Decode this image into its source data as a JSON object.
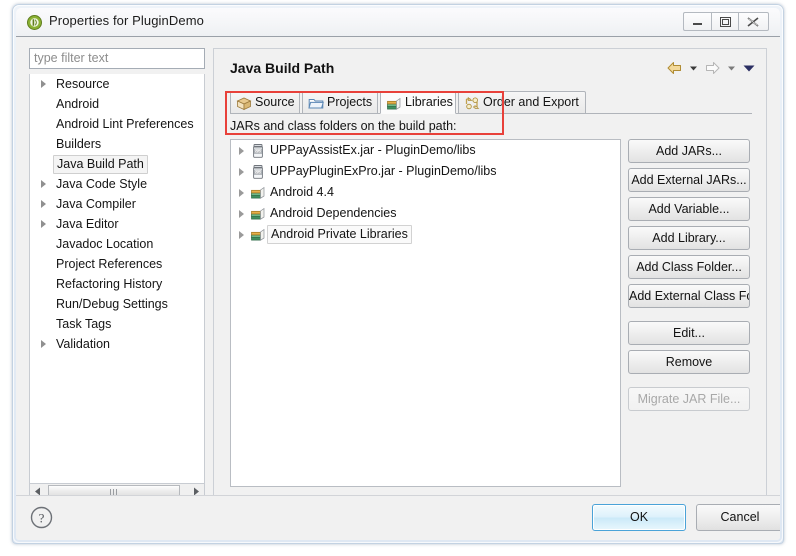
{
  "window": {
    "title": "Properties for PluginDemo",
    "icon": "eclipse-green-circle-icon",
    "controls": {
      "minimize": "minimize-icon",
      "maximize": "maximize-icon",
      "close": "close-icon"
    }
  },
  "sidebar": {
    "filter": {
      "placeholder": "type filter text",
      "value": ""
    },
    "items": [
      {
        "label": "Resource",
        "expandable": true,
        "selected": false
      },
      {
        "label": "Android",
        "expandable": false,
        "selected": false
      },
      {
        "label": "Android Lint Preferences",
        "expandable": false,
        "selected": false
      },
      {
        "label": "Builders",
        "expandable": false,
        "selected": false
      },
      {
        "label": "Java Build Path",
        "expandable": false,
        "selected": true
      },
      {
        "label": "Java Code Style",
        "expandable": true,
        "selected": false
      },
      {
        "label": "Java Compiler",
        "expandable": true,
        "selected": false
      },
      {
        "label": "Java Editor",
        "expandable": true,
        "selected": false
      },
      {
        "label": "Javadoc Location",
        "expandable": false,
        "selected": false
      },
      {
        "label": "Project References",
        "expandable": false,
        "selected": false
      },
      {
        "label": "Refactoring History",
        "expandable": false,
        "selected": false
      },
      {
        "label": "Run/Debug Settings",
        "expandable": false,
        "selected": false
      },
      {
        "label": "Task Tags",
        "expandable": false,
        "selected": false
      },
      {
        "label": "Validation",
        "expandable": true,
        "selected": false
      }
    ]
  },
  "main": {
    "page_title": "Java Build Path",
    "nav": {
      "back": "back-arrow-icon",
      "back_menu": "back-dropdown-icon",
      "forward": "forward-arrow-icon",
      "forward_menu": "forward-dropdown-icon",
      "menu": "view-menu-icon"
    },
    "tabs": [
      {
        "label": "Source",
        "icon": "source-package-icon",
        "active": false
      },
      {
        "label": "Projects",
        "icon": "folder-icon",
        "active": false
      },
      {
        "label": "Libraries",
        "icon": "library-books-icon",
        "active": true
      },
      {
        "label": "Order and Export",
        "icon": "order-export-icon",
        "active": false
      }
    ],
    "list_caption": "JARs and class folders on the build path:",
    "entries": [
      {
        "label": "UPPayAssistEx.jar - PluginDemo/libs",
        "icon": "jar-icon",
        "expandable": true,
        "selected": false,
        "highlighted": true
      },
      {
        "label": "UPPayPluginExPro.jar - PluginDemo/libs",
        "icon": "jar-icon",
        "expandable": true,
        "selected": false,
        "highlighted": true
      },
      {
        "label": "Android 4.4",
        "icon": "library-books-icon",
        "expandable": true,
        "selected": false,
        "highlighted": false
      },
      {
        "label": "Android Dependencies",
        "icon": "library-books-icon",
        "expandable": true,
        "selected": false,
        "highlighted": false
      },
      {
        "label": "Android Private Libraries",
        "icon": "library-books-icon",
        "expandable": true,
        "selected": true,
        "highlighted": false
      }
    ],
    "highlight_color": "#e8413a",
    "buttons": [
      {
        "label": "Add JARs...",
        "enabled": true
      },
      {
        "label": "Add External JARs...",
        "enabled": true
      },
      {
        "label": "Add Variable...",
        "enabled": true
      },
      {
        "label": "Add Library...",
        "enabled": true
      },
      {
        "label": "Add Class Folder...",
        "enabled": true
      },
      {
        "label": "Add External Class Folder...",
        "enabled": true
      },
      {
        "label": "Edit...",
        "enabled": true
      },
      {
        "label": "Remove",
        "enabled": true
      },
      {
        "label": "Migrate JAR File...",
        "enabled": false
      }
    ]
  },
  "footer": {
    "help": "help-question-icon",
    "ok_label": "OK",
    "cancel_label": "Cancel"
  }
}
